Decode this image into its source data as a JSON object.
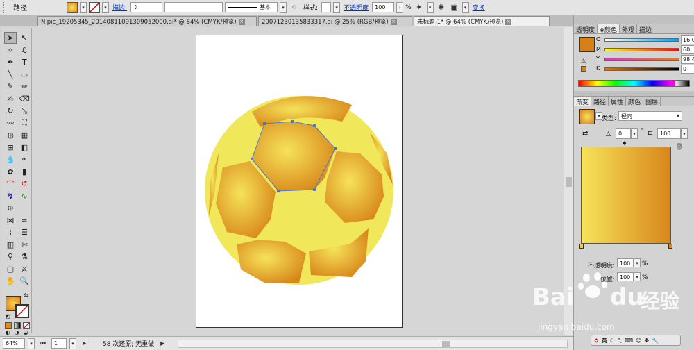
{
  "control_bar": {
    "object_type": "路径",
    "stroke_label": "描边:",
    "stroke_profile": "基本",
    "style_label": "样式:",
    "opacity_label": "不透明度",
    "opacity_value": "100",
    "percent": "%",
    "transform_label": "变换"
  },
  "tabs": [
    {
      "label": "Nipic_19205345_20140811091309052000.ai* @ 84% (CMYK/预览)",
      "active": false
    },
    {
      "label": "20071230135833317.ai @ 25% (RGB/预览)",
      "active": false
    },
    {
      "label": "未标题-1* @ 64% (CMYK/预览)",
      "active": true
    }
  ],
  "color_panel": {
    "tabs": [
      "透明度",
      "颜色",
      "外观",
      "描边"
    ],
    "channels": [
      {
        "label": "C",
        "value": "16.08",
        "gradient": "linear-gradient(90deg,#fff,#00a0e9)"
      },
      {
        "label": "M",
        "value": "60",
        "gradient": "linear-gradient(90deg,#ff0,#f00)"
      },
      {
        "label": "Y",
        "value": "98.43",
        "gradient": "linear-gradient(90deg,#d040c0,#e08020)"
      },
      {
        "label": "K",
        "value": "0",
        "gradient": "linear-gradient(90deg,#d87820,#000)"
      }
    ],
    "percent": "%",
    "fill_color": "#d6801a"
  },
  "gradient_panel": {
    "tabs": [
      "渐变",
      "路径",
      "属性",
      "颜色",
      "图层"
    ],
    "type_label": "类型:",
    "type_value": "径向",
    "angle_value": "0",
    "aspect_value": "100",
    "opacity_label": "不透明度:",
    "opacity_value": "100",
    "location_label": "位置:",
    "location_value": "100",
    "percent": "%"
  },
  "status_bar": {
    "zoom": "64%",
    "page": "1",
    "undo_text": "58 次还原; 无重做"
  },
  "colors": {
    "ball_base": "#f0e85a",
    "gradient_start": "#f6e35a",
    "gradient_end": "#d8861a",
    "path_anchor": "#4a78d8"
  },
  "watermark": {
    "brand": "Bai",
    "brand_tail": "du",
    "cn": "经验",
    "url": "jingyan.baidu.com"
  }
}
